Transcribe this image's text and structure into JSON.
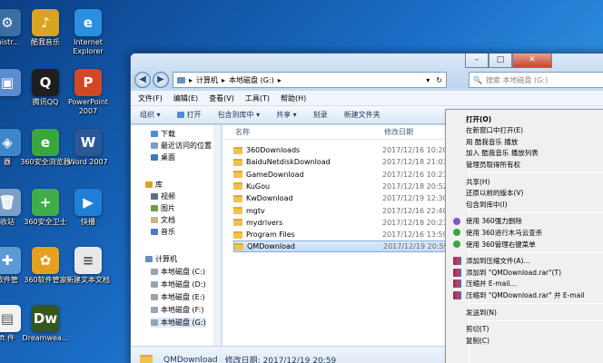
{
  "desktop": {
    "icons": [
      {
        "label": "inistr...",
        "color": "#3a6ea5",
        "glyph": "⚙"
      },
      {
        "label": "酷我音乐",
        "color": "#d9a520",
        "glyph": "♪"
      },
      {
        "label": "Internet Explorer",
        "color": "#2b8fe0",
        "glyph": "e"
      },
      {
        "label": "",
        "color": "#5b8bd0",
        "glyph": "▣"
      },
      {
        "label": "腾讯QQ",
        "color": "#1e1e1e",
        "glyph": "Q"
      },
      {
        "label": "PowerPoint 2007",
        "color": "#d24726",
        "glyph": "P"
      },
      {
        "label": "器",
        "color": "#3c86c9",
        "glyph": "◈"
      },
      {
        "label": "360安全浏览器",
        "color": "#3aa63f",
        "glyph": "e"
      },
      {
        "label": "Word 2007",
        "color": "#2b5797",
        "glyph": "W"
      },
      {
        "label": "收站",
        "color": "#7aa0c8",
        "glyph": "🗑"
      },
      {
        "label": "360安全卫士",
        "color": "#3fae49",
        "glyph": "+"
      },
      {
        "label": "快播",
        "color": "#1f7fd6",
        "glyph": "▶"
      },
      {
        "label": "软件管",
        "color": "#5b9ad5",
        "glyph": "✚"
      },
      {
        "label": "360软件管家",
        "color": "#e5a11e",
        "glyph": "✿"
      },
      {
        "label": "新建文本文档",
        "color": "#e8e8e8",
        "glyph": "≡"
      },
      {
        "label": "ft 件",
        "color": "#f2f2f2",
        "glyph": "▤"
      },
      {
        "label": "Dreamwea...",
        "color": "#35571e",
        "glyph": "Dw"
      }
    ]
  },
  "window": {
    "address": {
      "path": [
        "计算机",
        "本地磁盘 (G:)"
      ]
    },
    "search_placeholder": "搜索 本地磁盘 (G:)",
    "caption": {
      "minimize": "–",
      "maximize": "□",
      "close": "✕"
    },
    "menus": [
      "文件(F)",
      "编辑(E)",
      "查看(V)",
      "工具(T)",
      "帮助(H)"
    ],
    "toolbar": [
      "组织 ▾",
      "打开",
      "包含到库中 ▾",
      "共享 ▾",
      "刻录",
      "新建文件夹"
    ],
    "nav": {
      "favorites": [
        "下载",
        "最近访问的位置",
        "桌面"
      ],
      "libraries_title": "库",
      "libraries": [
        "视频",
        "图片",
        "文档",
        "音乐"
      ],
      "computer_title": "计算机",
      "drives": [
        "本地磁盘 (C:)",
        "本地磁盘 (D:)",
        "本地磁盘 (E:)",
        "本地磁盘 (F:)",
        "本地磁盘 (G:)"
      ]
    },
    "columns": {
      "name": "名称",
      "date": "修改日期"
    },
    "files": [
      {
        "name": "360Downloads",
        "date": "2017/12/16 10:20"
      },
      {
        "name": "BaiduNetdiskDownload",
        "date": "2017/12/18 21:03"
      },
      {
        "name": "GameDownload",
        "date": "2017/12/16 10:21"
      },
      {
        "name": "KuGou",
        "date": "2017/12/18 20:52"
      },
      {
        "name": "KwDownload",
        "date": "2017/12/19 12:30"
      },
      {
        "name": "mgtv",
        "date": "2017/12/16 22:40"
      },
      {
        "name": "mydrivers",
        "date": "2017/12/18 20:27"
      },
      {
        "name": "Program Files",
        "date": "2017/12/16 13:59"
      },
      {
        "name": "QMDownload",
        "date": "2017/12/19 20:59"
      }
    ],
    "details": {
      "name": "QMDownload",
      "text": "修改日期: 2017/12/19 20:59"
    }
  },
  "context_menu": {
    "items": [
      {
        "label": "打开(O)",
        "bold": true,
        "icon": ""
      },
      {
        "label": "在新窗口中打开(E)",
        "icon": ""
      },
      {
        "label": "用 酷我音乐 播放",
        "icon": ""
      },
      {
        "label": "加入 酷我音乐 播放列表",
        "icon": ""
      },
      {
        "label": "管理员取得所有权",
        "icon": ""
      },
      {
        "sep": true
      },
      {
        "label": "共享(H)",
        "icon": ""
      },
      {
        "label": "还原以前的版本(V)",
        "icon": ""
      },
      {
        "label": "包含到库中(I)",
        "icon": ""
      },
      {
        "sep": true
      },
      {
        "label": "使用 360强力删除",
        "icon": "#7e57c2"
      },
      {
        "label": "使用 360进行木马云查杀",
        "icon": "#3aa63f"
      },
      {
        "label": "使用 360管理右键菜单",
        "icon": "#3aa63f"
      },
      {
        "sep": true
      },
      {
        "label": "添加到压缩文件(A)...",
        "icon": "rar"
      },
      {
        "label": "添加到 \"QMDownload.rar\"(T)",
        "icon": "rar"
      },
      {
        "label": "压缩并 E-mail...",
        "icon": "rar"
      },
      {
        "label": "压缩到 \"QMDownload.rar\" 并 E-mail",
        "icon": "rar"
      },
      {
        "sep": true
      },
      {
        "label": "发送到(N)",
        "icon": ""
      },
      {
        "sep": true
      },
      {
        "label": "剪切(T)",
        "icon": ""
      },
      {
        "label": "复制(C)",
        "icon": ""
      }
    ]
  }
}
